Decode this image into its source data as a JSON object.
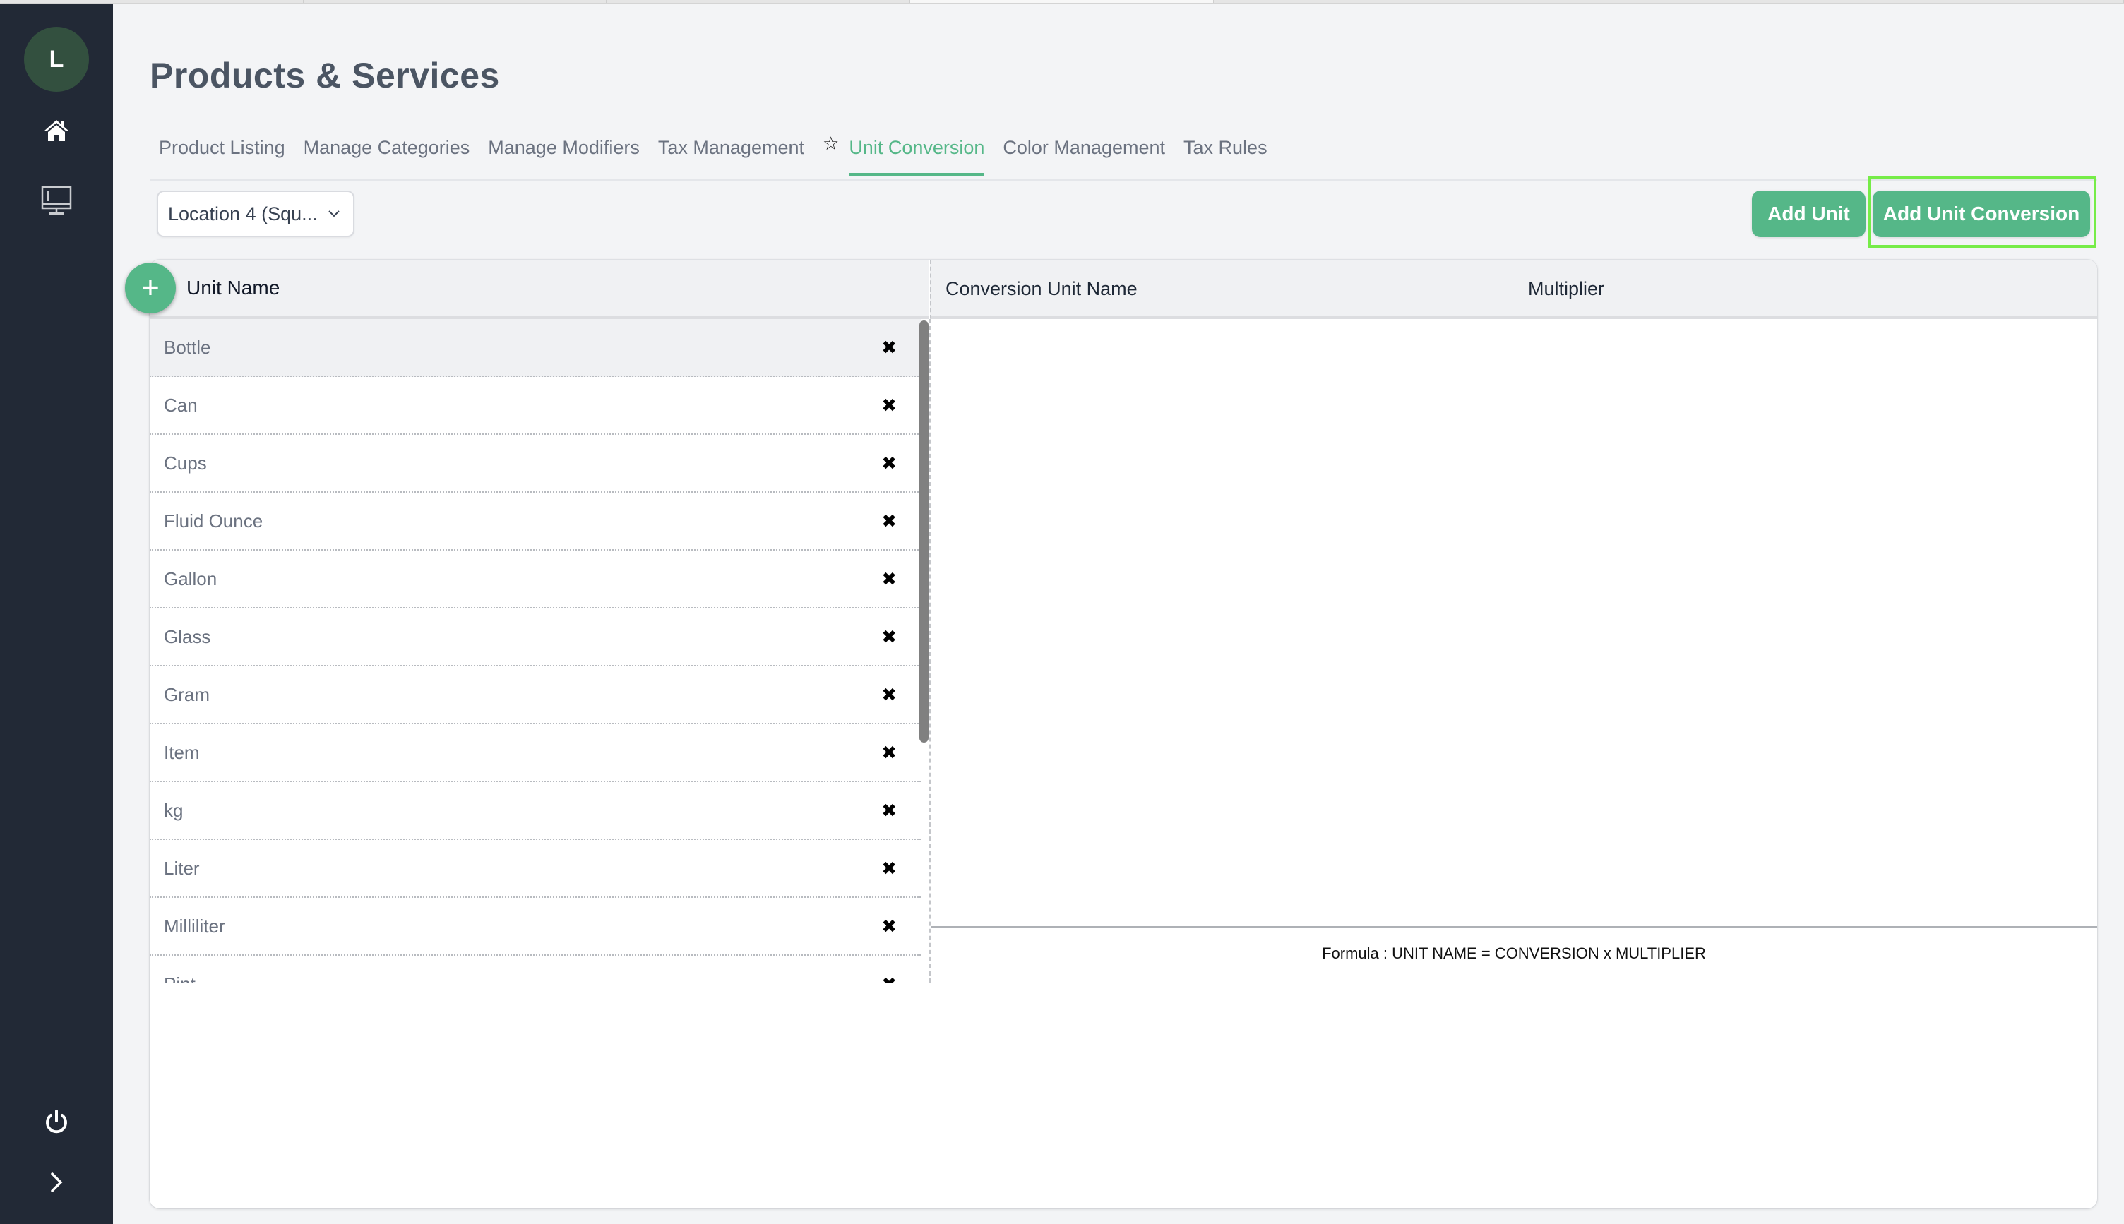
{
  "browser_tabs": 7,
  "sidebar": {
    "avatar_initial": "L",
    "icons": [
      "home-icon",
      "monitor-icon",
      "power-icon",
      "chevron-right-icon"
    ]
  },
  "page": {
    "title": "Products & Services"
  },
  "tabs": [
    {
      "label": "Product Listing",
      "active": false
    },
    {
      "label": "Manage Categories",
      "active": false
    },
    {
      "label": "Manage Modifiers",
      "active": false
    },
    {
      "label": "Tax Management",
      "active": false
    },
    {
      "label": "Unit Conversion",
      "active": true,
      "starred": true
    },
    {
      "label": "Color Management",
      "active": false
    },
    {
      "label": "Tax Rules",
      "active": false
    }
  ],
  "toolbar": {
    "location_selected": "Location 4 (Squ...",
    "add_unit_label": "Add Unit",
    "add_unit_conversion_label": "Add Unit Conversion"
  },
  "colors": {
    "accent": "#55b788",
    "sidebar_bg": "#222936",
    "avatar_bg": "#33503f",
    "highlight": "#76ec48"
  },
  "units_table": {
    "header": "Unit Name",
    "add_symbol": "+",
    "delete_symbol": "✖",
    "items": [
      {
        "name": "Bottle",
        "selected": true
      },
      {
        "name": "Can"
      },
      {
        "name": "Cups"
      },
      {
        "name": "Fluid Ounce"
      },
      {
        "name": "Gallon"
      },
      {
        "name": "Glass"
      },
      {
        "name": "Gram"
      },
      {
        "name": "Item"
      },
      {
        "name": "kg"
      },
      {
        "name": "Liter"
      },
      {
        "name": "Milliliter"
      },
      {
        "name": "Pint"
      }
    ]
  },
  "conversion_table": {
    "columns": [
      "Conversion Unit Name",
      "Multiplier"
    ],
    "rows": [],
    "formula": "Formula : UNIT NAME = CONVERSION x MULTIPLIER"
  }
}
